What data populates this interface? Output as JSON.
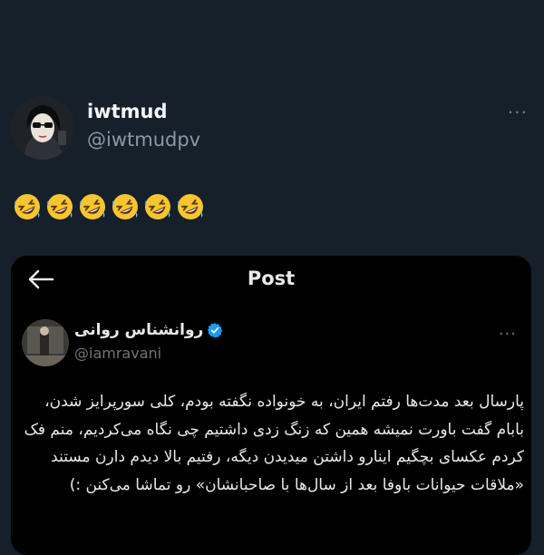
{
  "tweet": {
    "display_name": "iwtmud",
    "handle": "@iwtmudpv",
    "more_label": "···",
    "emoji_count": 6,
    "emoji_name": "rolling-on-the-floor-laughing"
  },
  "quoted": {
    "header_title": "Post",
    "display_name": "روانشناس روانی",
    "verified": true,
    "handle": "@iamravani",
    "more_label": "···",
    "text": "پارسال بعد مدت‌ها رفتم ایران، به خونواده نگفته بودم، کلی سورپرایز شدن، بابام گفت باورت نمیشه همین که زنگ زدی داشتیم چی نگاه می‌کردیم، منم فک کردم عکسای بچگیم اینارو داشتن میدیدن دیگه، رفتیم بالا دیدم دارن مستند «ملاقات حیوانات باوفا بعد از سال‌ها با صاحبانشان» رو تماشا می‌کنن :)"
  },
  "colors": {
    "background": "#15202b",
    "card": "#000000",
    "verified_blue": "#1d9bf0",
    "muted": "#8b98a5"
  },
  "icons": [
    "avatar-illustration",
    "rofl-emoji",
    "back-arrow-icon",
    "verified-badge-icon",
    "more-icon"
  ]
}
